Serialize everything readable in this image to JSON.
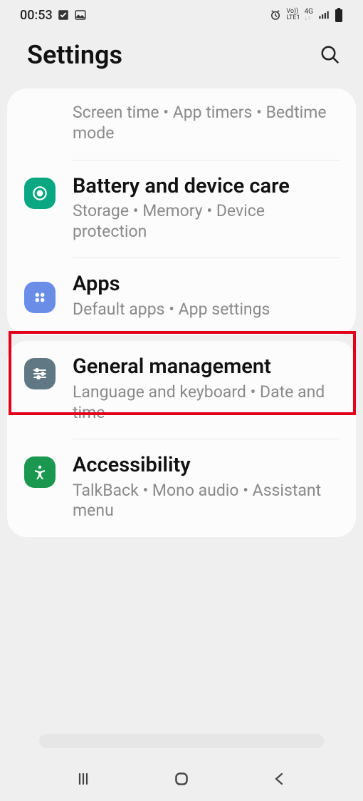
{
  "statusbar": {
    "time": "00:53",
    "network_label_top": "Vo))",
    "network_label_bot": "LTE1",
    "data_label": "4G"
  },
  "header": {
    "title": "Settings"
  },
  "cards": [
    {
      "rows": [
        {
          "title": "",
          "subtitle": "Screen time  •  App timers  •  Bedtime mode"
        },
        {
          "title": "Battery and device care",
          "subtitle": "Storage  •  Memory  •  Device protection"
        },
        {
          "title": "Apps",
          "subtitle": "Default apps  •  App settings"
        }
      ]
    },
    {
      "rows": [
        {
          "title": "General management",
          "subtitle": "Language and keyboard  •  Date and time"
        },
        {
          "title": "Accessibility",
          "subtitle": "TalkBack  •  Mono audio  •  Assistant menu"
        }
      ]
    }
  ]
}
